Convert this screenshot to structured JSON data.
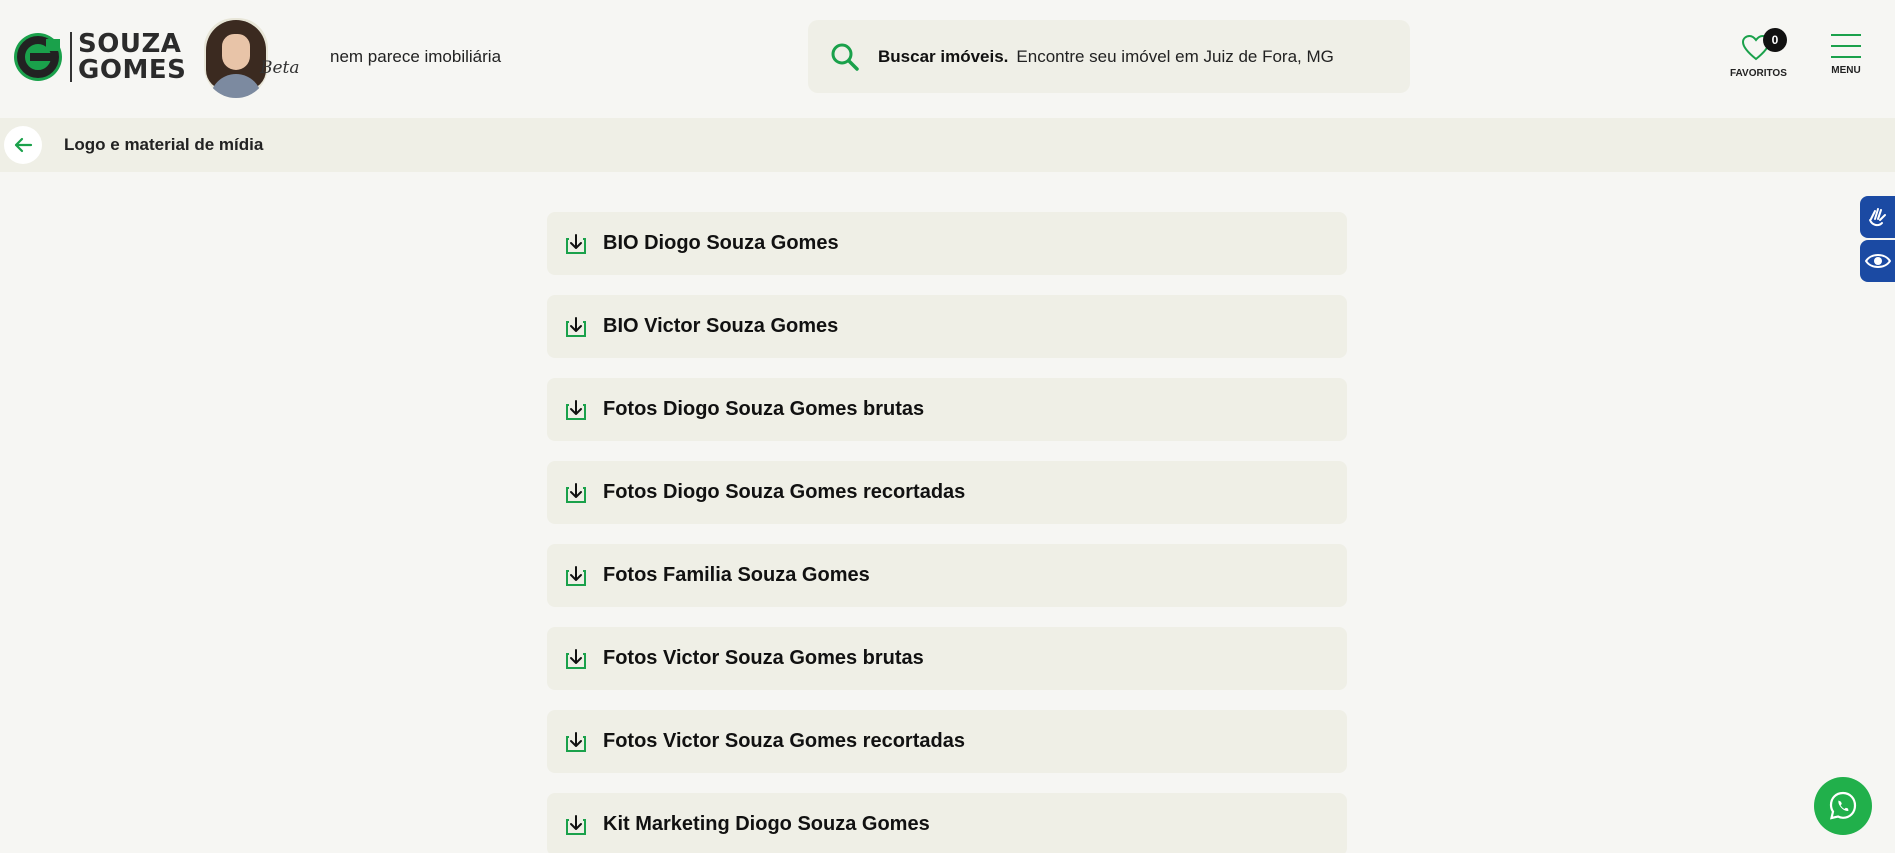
{
  "brand": {
    "name_line1": "SOUZA",
    "name_line2": "GOMES",
    "beta_script": "Beta",
    "tagline": "nem parece imobiliária",
    "accent": "#1aa14b"
  },
  "search": {
    "label": "Buscar imóveis.",
    "text": "Encontre seu imóvel em Juiz de Fora, MG",
    "icon": "search-icon"
  },
  "nav": {
    "favorites_label": "FAVORITOS",
    "favorites_count": "0",
    "menu_label": "MENU"
  },
  "subheader": {
    "title": "Logo e material de mídia"
  },
  "downloads": [
    {
      "label": "BIO Diogo Souza Gomes"
    },
    {
      "label": "BIO Victor Souza Gomes"
    },
    {
      "label": "Fotos Diogo Souza Gomes brutas"
    },
    {
      "label": "Fotos Diogo Souza Gomes recortadas"
    },
    {
      "label": "Fotos Familia Souza Gomes"
    },
    {
      "label": "Fotos Victor Souza Gomes brutas"
    },
    {
      "label": "Fotos Victor Souza Gomes recortadas"
    },
    {
      "label": "Kit Marketing Diogo Souza Gomes"
    }
  ],
  "widgets": {
    "a11y_color": "#1b4aa3",
    "whatsapp_color": "#21b04b"
  }
}
